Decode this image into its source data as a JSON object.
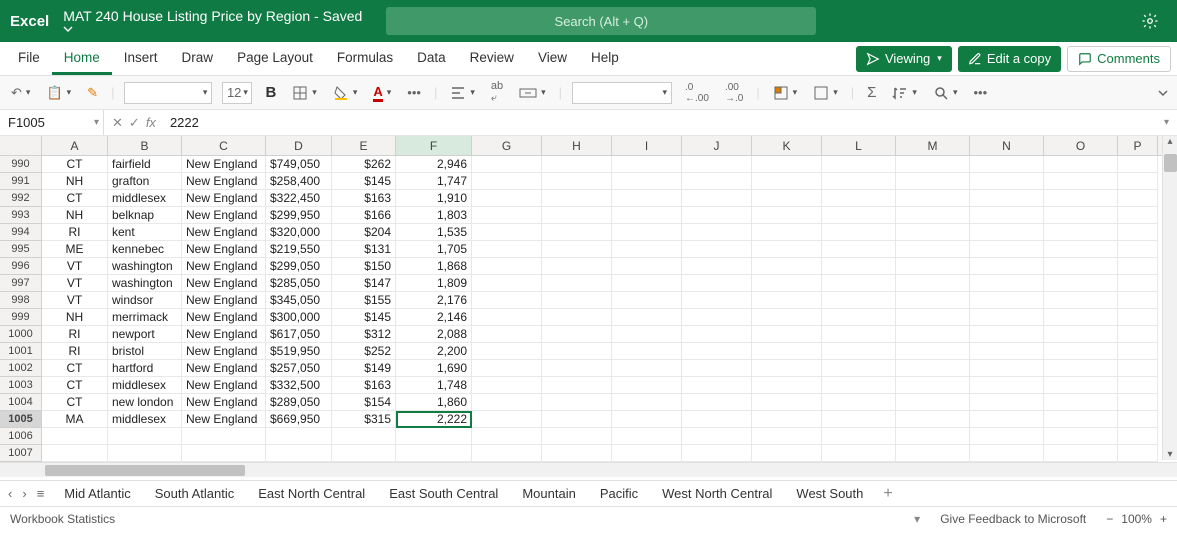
{
  "title": {
    "app": "Excel",
    "doc": "MAT 240 House Listing Price by Region",
    "saved": "Saved"
  },
  "search": {
    "placeholder": "Search (Alt + Q)"
  },
  "tabs": [
    "File",
    "Home",
    "Insert",
    "Draw",
    "Page Layout",
    "Formulas",
    "Data",
    "Review",
    "View",
    "Help"
  ],
  "active_tab": "Home",
  "actions": {
    "viewing": "Viewing",
    "edit_copy": "Edit a copy",
    "comments": "Comments"
  },
  "toolbar": {
    "font_size": "12"
  },
  "name_box": "F1005",
  "formula": "2222",
  "columns": [
    "A",
    "B",
    "C",
    "D",
    "E",
    "F",
    "G",
    "H",
    "I",
    "J",
    "K",
    "L",
    "M",
    "N",
    "O",
    "P"
  ],
  "selected_cell": {
    "row": 1005,
    "col": "F"
  },
  "rows": [
    {
      "n": 990,
      "A": "CT",
      "B": "fairfield",
      "C": "New England",
      "D": "$749,050",
      "E": "$262",
      "F": "2,946"
    },
    {
      "n": 991,
      "A": "NH",
      "B": "grafton",
      "C": "New England",
      "D": "$258,400",
      "E": "$145",
      "F": "1,747"
    },
    {
      "n": 992,
      "A": "CT",
      "B": "middlesex",
      "C": "New England",
      "D": "$322,450",
      "E": "$163",
      "F": "1,910"
    },
    {
      "n": 993,
      "A": "NH",
      "B": "belknap",
      "C": "New England",
      "D": "$299,950",
      "E": "$166",
      "F": "1,803"
    },
    {
      "n": 994,
      "A": "RI",
      "B": "kent",
      "C": "New England",
      "D": "$320,000",
      "E": "$204",
      "F": "1,535"
    },
    {
      "n": 995,
      "A": "ME",
      "B": "kennebec",
      "C": "New England",
      "D": "$219,550",
      "E": "$131",
      "F": "1,705"
    },
    {
      "n": 996,
      "A": "VT",
      "B": "washington",
      "C": "New England",
      "D": "$299,050",
      "E": "$150",
      "F": "1,868"
    },
    {
      "n": 997,
      "A": "VT",
      "B": "washington",
      "C": "New England",
      "D": "$285,050",
      "E": "$147",
      "F": "1,809"
    },
    {
      "n": 998,
      "A": "VT",
      "B": "windsor",
      "C": "New England",
      "D": "$345,050",
      "E": "$155",
      "F": "2,176"
    },
    {
      "n": 999,
      "A": "NH",
      "B": "merrimack",
      "C": "New England",
      "D": "$300,000",
      "E": "$145",
      "F": "2,146"
    },
    {
      "n": 1000,
      "A": "RI",
      "B": "newport",
      "C": "New England",
      "D": "$617,050",
      "E": "$312",
      "F": "2,088"
    },
    {
      "n": 1001,
      "A": "RI",
      "B": "bristol",
      "C": "New England",
      "D": "$519,950",
      "E": "$252",
      "F": "2,200"
    },
    {
      "n": 1002,
      "A": "CT",
      "B": "hartford",
      "C": "New England",
      "D": "$257,050",
      "E": "$149",
      "F": "1,690"
    },
    {
      "n": 1003,
      "A": "CT",
      "B": "middlesex",
      "C": "New England",
      "D": "$332,500",
      "E": "$163",
      "F": "1,748"
    },
    {
      "n": 1004,
      "A": "CT",
      "B": "new london",
      "C": "New England",
      "D": "$289,050",
      "E": "$154",
      "F": "1,860"
    },
    {
      "n": 1005,
      "A": "MA",
      "B": "middlesex",
      "C": "New England",
      "D": "$669,950",
      "E": "$315",
      "F": "2,222"
    },
    {
      "n": 1006
    },
    {
      "n": 1007
    }
  ],
  "sheets": [
    "Mid Atlantic",
    "South Atlantic",
    "East North Central",
    "East South Central",
    "Mountain",
    "Pacific",
    "West North Central",
    "West South"
  ],
  "status": {
    "left": "Workbook Statistics",
    "feedback": "Give Feedback to Microsoft",
    "zoom": "100%"
  }
}
